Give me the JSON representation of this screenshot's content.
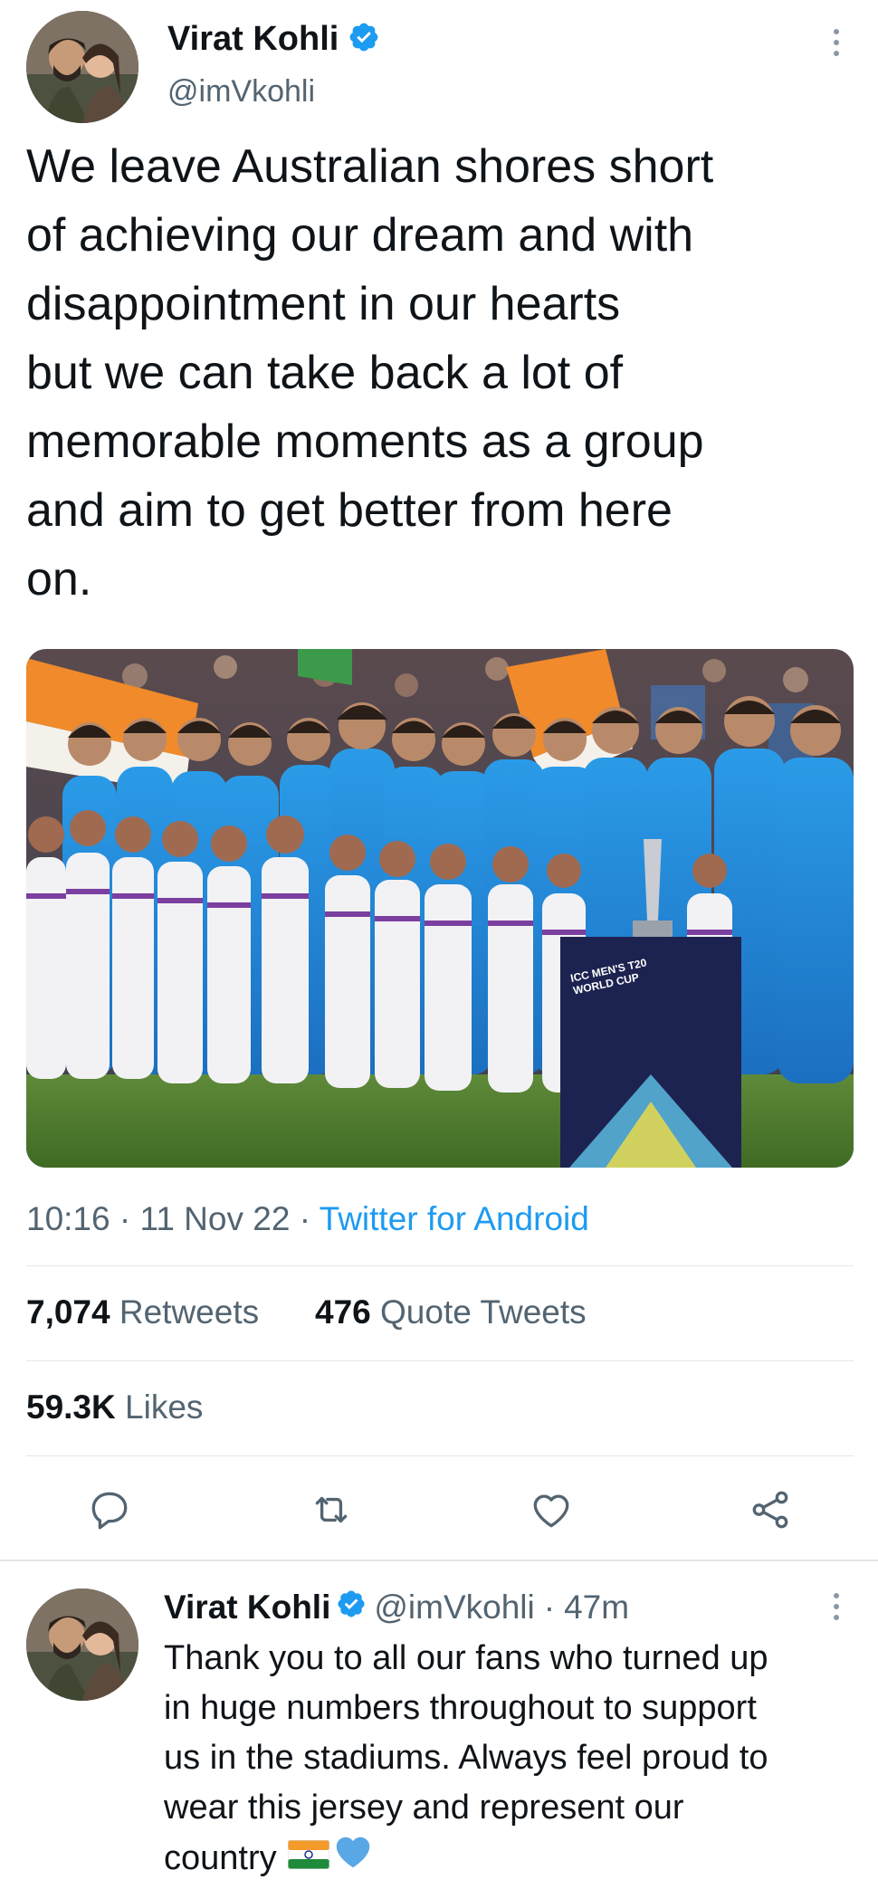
{
  "main_tweet": {
    "author_name": "Virat Kohli",
    "handle": "@imVkohli",
    "text": "We leave Australian shores short of achieving our dream and with disappointment in our hearts but we can take back a lot of memorable moments as a group and aim to get better from here on.",
    "text_lines": [
      "We leave Australian shores short",
      "of achieving our dream and with",
      "disappointment in our hearts",
      "but we can take back a lot of",
      "memorable moments as a group",
      "and aim to get better from here",
      "on."
    ],
    "time": "10:16",
    "date": "11 Nov 22",
    "source": "Twitter for Android",
    "separator": "·",
    "retweets_count": "7,074",
    "retweets_label": "Retweets",
    "quotes_count": "476",
    "quotes_label": "Quote Tweets",
    "likes_count": "59.3K",
    "likes_label": "Likes",
    "media_trophy_text": [
      "ICC MEN'S T20",
      "WORLD CUP"
    ]
  },
  "reply_tweet": {
    "author_name": "Virat Kohli",
    "handle": "@imVkohli",
    "separator": "·",
    "time_ago": "47m",
    "text_lines": [
      "Thank you to all our fans who turned up",
      "in huge numbers throughout to support",
      "us in the stadiums. Always feel proud to",
      "wear this jersey and represent our",
      "country"
    ],
    "emoji": [
      "india-flag-emoji",
      "blue-heart-emoji"
    ]
  },
  "actions": [
    "reply-icon",
    "retweet-icon",
    "like-icon",
    "share-icon"
  ],
  "colors": {
    "accent": "#1d9bf0",
    "text": "#0f1419",
    "muted": "#536471",
    "divider": "#e3e6ea",
    "jersey": "#1f86d6"
  }
}
